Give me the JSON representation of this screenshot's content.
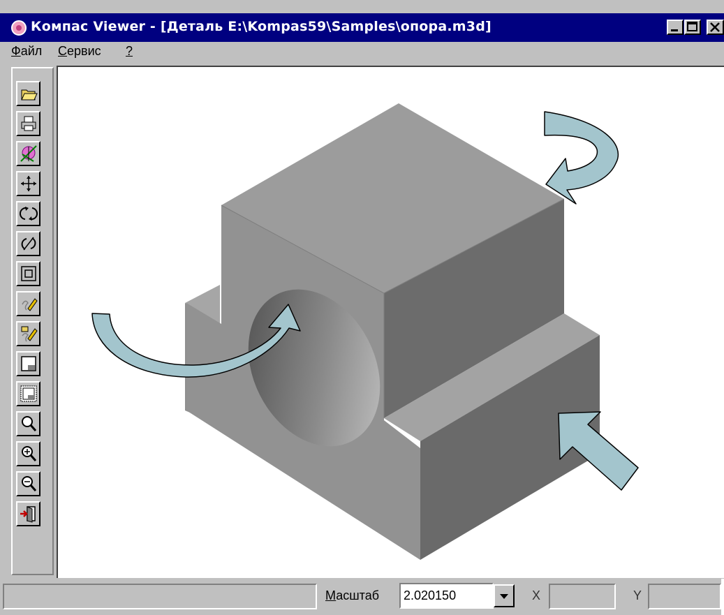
{
  "window": {
    "title": "Компас Viewer - [Деталь E:\\Kompas59\\Samples\\опора.m3d]"
  },
  "menu": [
    {
      "mnemonic": "Ф",
      "rest": "айл"
    },
    {
      "mnemonic": "С",
      "rest": "ервис"
    },
    {
      "mnemonic": "?",
      "rest": ""
    }
  ],
  "toolbar_icons": [
    "open-icon",
    "print-icon",
    "view-orientation-icon",
    "pan-icon",
    "rotate-icon",
    "rotate-axis-icon",
    "fit-window-icon",
    "edit-icon",
    "edit-properties-icon",
    "window-icon",
    "frame-window-icon",
    "zoom-icon",
    "zoom-in-icon",
    "zoom-out-icon",
    "exit-icon"
  ],
  "statusbar": {
    "scale_mnemonic": "М",
    "scale_rest": "асштаб",
    "scale_value": "2.020150",
    "x_label": "X",
    "y_label": "Y"
  },
  "colors": {
    "title_bar": "#000080",
    "face_top": "#9c9c9c",
    "face_front": "#8f8f8f",
    "face_side": "#6c6c6c",
    "arrow_fill": "#a3c5cd"
  }
}
